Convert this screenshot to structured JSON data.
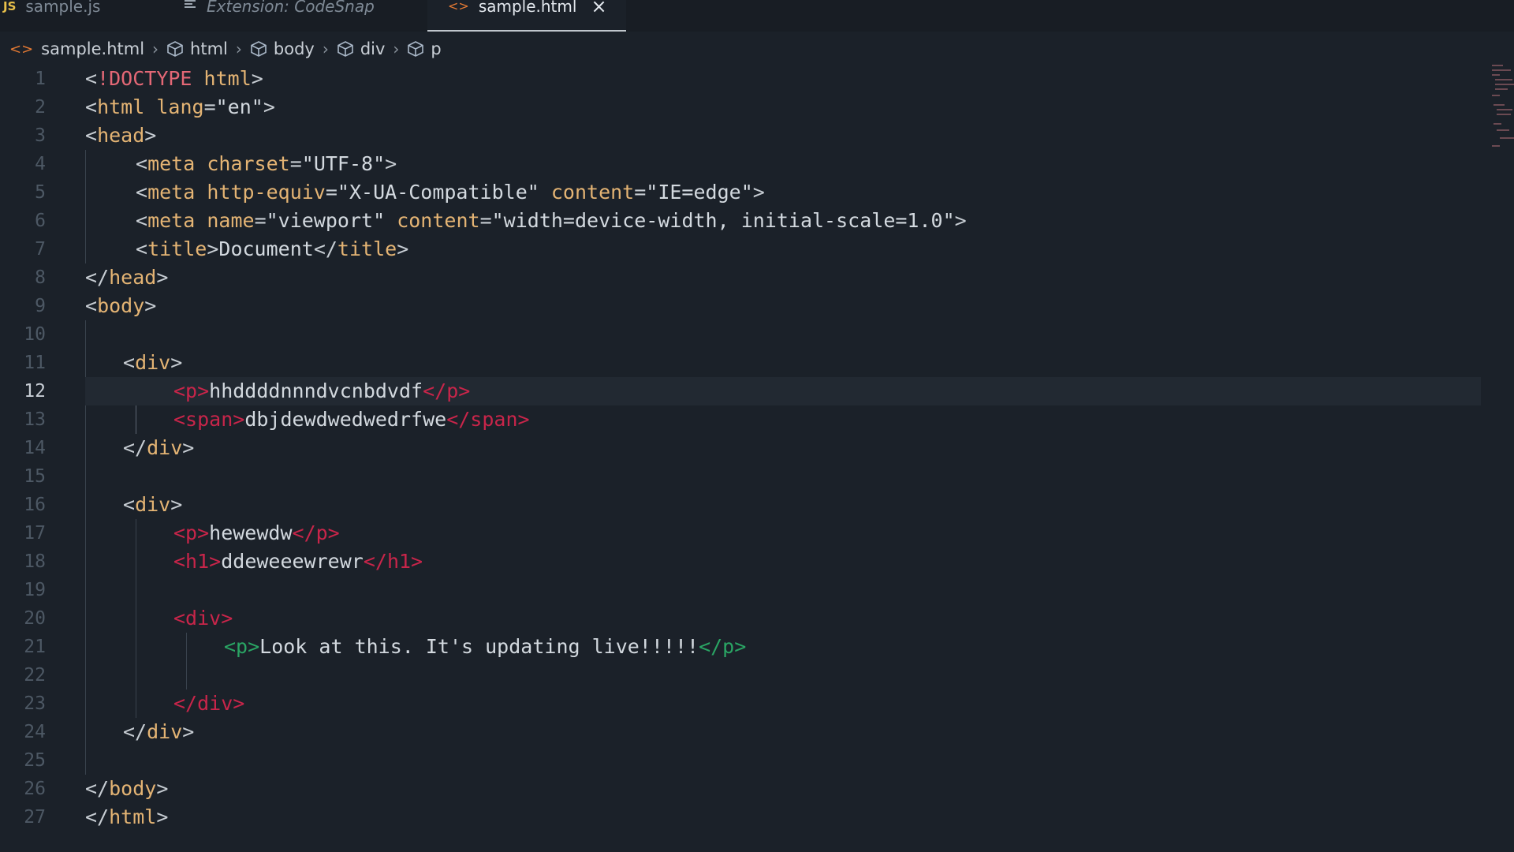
{
  "tabs": [
    {
      "icon": "js-icon",
      "icon_text": "JS",
      "label": "sample.js",
      "active": false,
      "italic": false
    },
    {
      "icon": "lines-icon",
      "icon_text": "",
      "label": "Extension: CodeSnap",
      "active": false,
      "italic": true
    },
    {
      "icon": "html-icon",
      "icon_text": "",
      "label": "sample.html",
      "active": true,
      "italic": false,
      "close_icon": "close-icon"
    }
  ],
  "breadcrumb": [
    {
      "icon": "html-file-icon",
      "label": "sample.html"
    },
    {
      "icon": "cube-icon",
      "label": "html"
    },
    {
      "icon": "cube-icon",
      "label": "body"
    },
    {
      "icon": "cube-icon",
      "label": "div"
    },
    {
      "icon": "cube-icon",
      "label": "p"
    }
  ],
  "editor": {
    "current_line": 12,
    "lines": [
      {
        "n": "1",
        "text": "<!DOCTYPE html>"
      },
      {
        "n": "2",
        "text": "<html lang=\"en\">"
      },
      {
        "n": "3",
        "text": "<head>"
      },
      {
        "n": "4",
        "text": "    <meta charset=\"UTF-8\">"
      },
      {
        "n": "5",
        "text": "    <meta http-equiv=\"X-UA-Compatible\" content=\"IE=edge\">"
      },
      {
        "n": "6",
        "text": "    <meta name=\"viewport\" content=\"width=device-width, initial-scale=1.0\">"
      },
      {
        "n": "7",
        "text": "    <title>Document</title>"
      },
      {
        "n": "8",
        "text": "</head>"
      },
      {
        "n": "9",
        "text": "<body>"
      },
      {
        "n": "10",
        "text": ""
      },
      {
        "n": "11",
        "text": "   <div>"
      },
      {
        "n": "12",
        "text": "       <p>hhddddnnndvcnbdvdf</p>"
      },
      {
        "n": "13",
        "text": "       <span>dbjdewdwedwedrfwe</span>"
      },
      {
        "n": "14",
        "text": "   </div>"
      },
      {
        "n": "15",
        "text": ""
      },
      {
        "n": "16",
        "text": "   <div>"
      },
      {
        "n": "17",
        "text": "       <p>hewewdw</p>"
      },
      {
        "n": "18",
        "text": "       <h1>ddeweeewrewr</h1>"
      },
      {
        "n": "19",
        "text": ""
      },
      {
        "n": "20",
        "text": "       <div>"
      },
      {
        "n": "21",
        "text": "           <p>Look at this. It's updating live!!!!!</p>"
      },
      {
        "n": "22",
        "text": ""
      },
      {
        "n": "23",
        "text": "       </div>"
      },
      {
        "n": "24",
        "text": "   </div>"
      },
      {
        "n": "25",
        "text": ""
      },
      {
        "n": "26",
        "text": "</body>"
      },
      {
        "n": "27",
        "text": "</html>"
      }
    ]
  },
  "colors": {
    "background": "#1b2129",
    "tag": "#e4b474",
    "doctype": "#e46876",
    "highlight_red": "#c8254a",
    "highlight_green": "#2aa564",
    "text": "#d3d9df"
  }
}
